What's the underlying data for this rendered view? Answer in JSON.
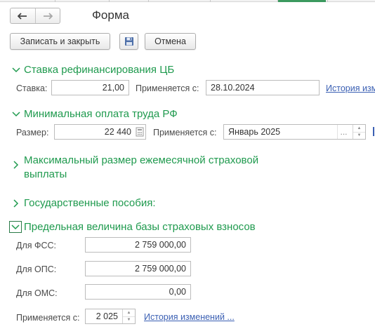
{
  "window": {
    "title": "Форма",
    "nav": {
      "back_icon": "arrow-left-icon",
      "forward_icon": "arrow-right-icon"
    }
  },
  "toolbar": {
    "save_close_label": "Записать и закрыть",
    "save_icon": "floppy-disk-icon",
    "cancel_label": "Отмена"
  },
  "sections": {
    "refinancing": {
      "title": "Ставка рефинансирования ЦБ",
      "expanded": true,
      "rate_label": "Ставка:",
      "rate_value": "21,00",
      "applies_label": "Применяется с:",
      "applies_value": "28.10.2024",
      "history_link": "История изм"
    },
    "mrot": {
      "title": "Минимальная оплата труда РФ",
      "expanded": true,
      "size_label": "Размер:",
      "size_value": "22 440",
      "applies_label": "Применяется с:",
      "applies_value": "Январь 2025",
      "select_dots": "...",
      "calc_icon": "calculator-icon"
    },
    "max_insurance": {
      "title_line1": "Максимальный размер ежемесячной страховой",
      "title_line2": "выплаты",
      "expanded": false
    },
    "state_benefits": {
      "title": "Государственные пособия:",
      "expanded": false
    },
    "contribution_base": {
      "title": "Предельная величина базы страховых взносов",
      "expanded": true,
      "fss_label": "Для ФСС:",
      "fss_value": "2 759 000,00",
      "ops_label": "Для ОПС:",
      "ops_value": "2 759 000,00",
      "oms_label": "Для ОМС:",
      "oms_value": "0,00",
      "applies_label": "Применяется с:",
      "applies_value": "2 025",
      "history_link": "История изменений ..."
    }
  },
  "colors": {
    "section_green": "#1f9a4e",
    "link_blue": "#3a5fb3",
    "field_border": "#bcbcbc",
    "active_tab": "#3c9a5f"
  }
}
